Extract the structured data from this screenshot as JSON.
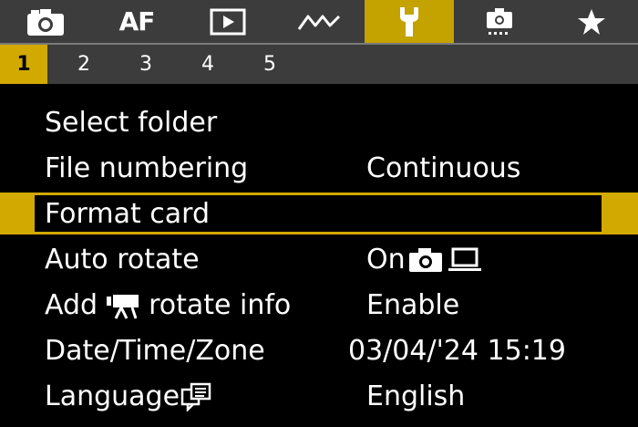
{
  "tabs": [
    {
      "id": "shooting",
      "icon": "camera-icon"
    },
    {
      "id": "af",
      "label": "AF"
    },
    {
      "id": "playback",
      "icon": "play-icon"
    },
    {
      "id": "wireless",
      "icon": "wireless-icon"
    },
    {
      "id": "setup",
      "icon": "wrench-icon"
    },
    {
      "id": "custom",
      "icon": "custom-function-icon"
    },
    {
      "id": "mymenu",
      "icon": "star-icon"
    }
  ],
  "pages": [
    "1",
    "2",
    "3",
    "4",
    "5"
  ],
  "active_page": "1",
  "menu": {
    "items": [
      {
        "label": "Select folder",
        "value": ""
      },
      {
        "label": "File numbering",
        "value": "Continuous"
      },
      {
        "label": "Format card",
        "value": ""
      },
      {
        "label": "Auto rotate",
        "value": "On"
      },
      {
        "label_prefix": "Add",
        "label_suffix": "rotate info",
        "value": "Enable"
      },
      {
        "label": "Date/Time/Zone",
        "value": "03/04/'24 15:19"
      },
      {
        "label": "Language",
        "value": "English"
      }
    ]
  },
  "colors": {
    "accent": "#d2a900",
    "tab_bar": "#3c3c3c",
    "background": "#000000",
    "text": "#ffffff"
  }
}
